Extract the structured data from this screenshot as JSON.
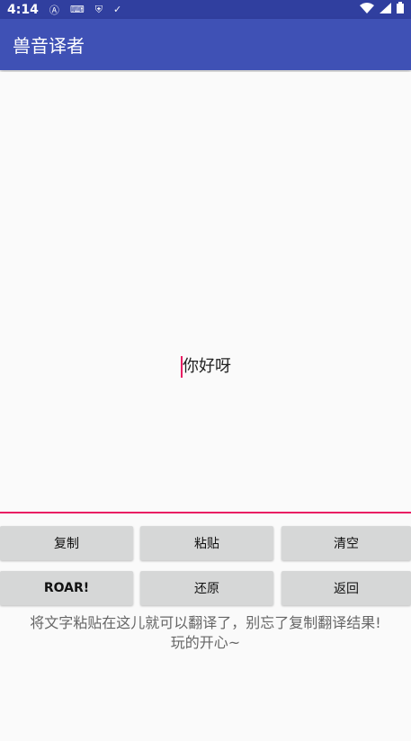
{
  "status_bar": {
    "time": "4:14",
    "icons": [
      "a-icon",
      "keyboard-icon",
      "shield-icon",
      "check-icon",
      "wifi-icon",
      "signal-icon",
      "battery-icon"
    ]
  },
  "app_bar": {
    "title": "兽音译者"
  },
  "editor": {
    "value": "你好呀"
  },
  "buttons": {
    "copy": "复制",
    "paste": "粘贴",
    "clear": "清空",
    "roar": "ROAR!",
    "restore": "还原",
    "back": "返回"
  },
  "hint": {
    "line1": "将文字粘贴在这儿就可以翻译了，别忘了复制翻译结果!",
    "line2": "玩的开心~"
  },
  "colors": {
    "primary": "#3f51b5",
    "primary_dark": "#303f9f",
    "accent": "#e91e63"
  }
}
